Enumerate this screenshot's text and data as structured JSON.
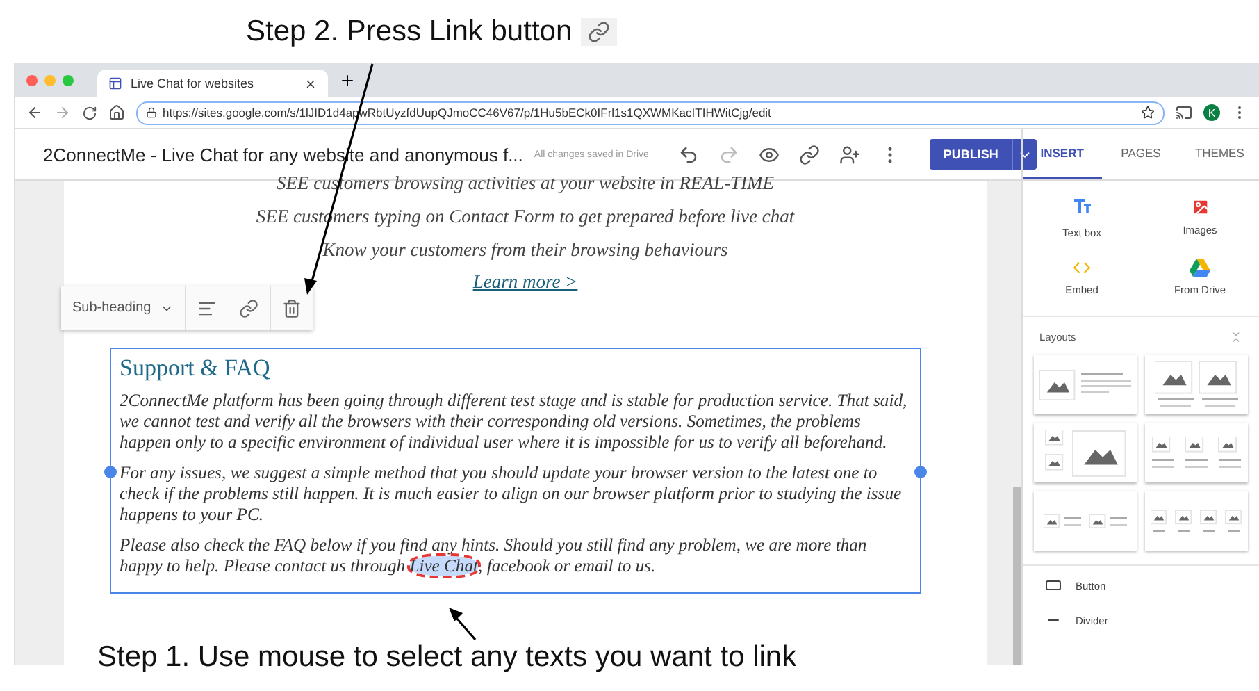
{
  "annotations": {
    "step_2": "Step 2. Press Link button",
    "step_1": "Step 1. Use mouse to select any texts you want to link"
  },
  "browser": {
    "tabs": [
      {
        "title": "Live Chat for websites",
        "selected": true
      }
    ],
    "url": "https://sites.google.com/s/1lJID1d4apwRbtUyzfdUupQJmoCC46V67/p/1Hu5bECk0IFrl1s1QXWMKacITIHWitCjg/edit",
    "profile_initial": "K"
  },
  "app": {
    "site_title": "2ConnectMe - Live Chat for any website and anonymous f...",
    "save_status": "All changes saved in Drive",
    "publish": "PUBLISH"
  },
  "page": {
    "lines": [
      "SEE customers browsing activities at your website in REAL-TIME",
      "SEE customers typing on Contact Form to get prepared before live chat",
      "Know your customers from their browsing behaviours"
    ],
    "link": "Learn more >",
    "format_toolbar": {
      "style": "Sub-heading"
    },
    "section": {
      "heading": "Support & FAQ",
      "paragraphs": [
        {
          "segments": [
            {
              "text": "2ConnectMe platform has been going through different test stage and is stable for production service. That said, we cannot test and verify all the browsers with their corresponding old versions. Sometimes, the problems happen only to a specific environment of individual user where it is impossible for us to verify all beforehand.",
              "selected": false
            }
          ]
        },
        {
          "segments": [
            {
              "text": "For any issues, we suggest a simple method that you should update your browser version to the latest one to check if the problems still happen. It is much easier to align on our browser platform prior to studying the issue happens to your PC.",
              "selected": false
            }
          ]
        },
        {
          "segments": [
            {
              "text": "Please also check the FAQ below if you find any hints. Should you still find any problem, we are more than happy to help. Please contact us through ",
              "selected": false
            },
            {
              "text": "Live Chat",
              "selected": true
            },
            {
              "text": ", facebook or email to us.",
              "selected": false
            }
          ]
        }
      ]
    }
  },
  "panel": {
    "tabs": [
      {
        "label": "INSERT",
        "selected": true
      },
      {
        "label": "PAGES",
        "selected": false
      },
      {
        "label": "THEMES",
        "selected": false
      }
    ],
    "insert_items": [
      {
        "kind": "textbox",
        "label": "Text box"
      },
      {
        "kind": "images",
        "label": "Images"
      },
      {
        "kind": "embed",
        "label": "Embed"
      },
      {
        "kind": "drive",
        "label": "From Drive"
      }
    ],
    "layouts_title": "Layouts",
    "layouts": [
      {
        "kind": "image-text"
      },
      {
        "kind": "two-images"
      },
      {
        "kind": "gallery"
      },
      {
        "kind": "three-cards"
      },
      {
        "kind": "two-items"
      },
      {
        "kind": "four-cards"
      }
    ],
    "components": [
      {
        "kind": "button",
        "label": "Button"
      },
      {
        "kind": "divider",
        "label": "Divider"
      }
    ]
  }
}
